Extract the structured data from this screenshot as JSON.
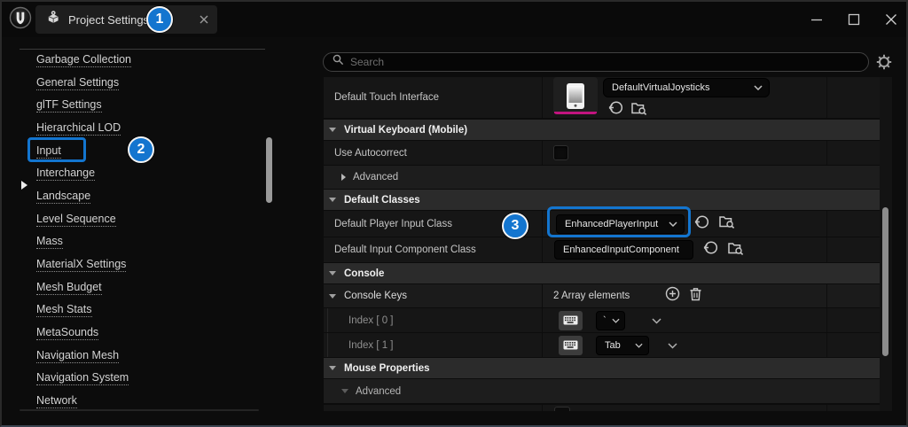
{
  "titlebar": {
    "tab_title": "Project Settings"
  },
  "annotations": {
    "step1": "1",
    "step2": "2",
    "step3": "3"
  },
  "sidebar": {
    "items": [
      "Garbage Collection",
      "General Settings",
      "glTF Settings",
      "Hierarchical LOD",
      "Input",
      "Interchange",
      "Landscape",
      "Level Sequence",
      "Mass",
      "MaterialX Settings",
      "Mesh Budget",
      "Mesh Stats",
      "MetaSounds",
      "Navigation Mesh",
      "Navigation System",
      "Network"
    ],
    "selected": "Input"
  },
  "panel": {
    "search_placeholder": "Search",
    "rows": {
      "touch": {
        "label": "Default Touch Interface",
        "value": "DefaultVirtualJoysticks"
      },
      "vk_header": "Virtual Keyboard (Mobile)",
      "autocorrect": {
        "label": "Use Autocorrect",
        "checked": false
      },
      "advanced_vk": "Advanced",
      "classes_header": "Default Classes",
      "player_input": {
        "label": "Default Player Input Class",
        "value": "EnhancedPlayerInput"
      },
      "input_component": {
        "label": "Default Input Component Class",
        "value": "EnhancedInputComponent"
      },
      "console_header": "Console",
      "console_keys": {
        "label": "Console Keys",
        "value": "2 Array elements"
      },
      "index0": {
        "label": "Index [ 0 ]",
        "value": "`"
      },
      "index1": {
        "label": "Index [ 1 ]",
        "value": "Tab"
      },
      "mouse_header": "Mouse Properties",
      "advanced_mouse": "Advanced"
    }
  },
  "colors": {
    "annotation_accent": "#1375cf",
    "asset_color_bar": "#c2147f"
  }
}
